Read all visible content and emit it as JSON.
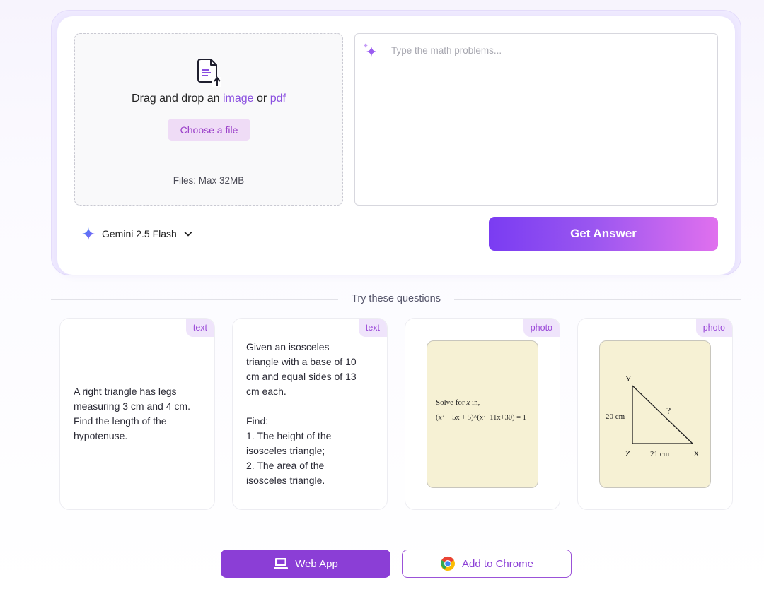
{
  "upload": {
    "drop_prefix": "Drag and drop an",
    "drop_image": "image",
    "drop_or": "or",
    "drop_pdf": "pdf",
    "choose_label": "Choose a file",
    "max_size": "Files: Max 32MB"
  },
  "input": {
    "placeholder": "Type the math problems..."
  },
  "model": {
    "name": "Gemini 2.5 Flash",
    "icon": "gemini-sparkle-icon"
  },
  "actions": {
    "get_answer": "Get Answer"
  },
  "examples": {
    "title": "Try these questions",
    "cards": [
      {
        "tag": "text",
        "lines": [
          "A right triangle has legs",
          "measuring 3 cm and 4 cm.",
          "Find the length of the",
          "hypotenuse."
        ]
      },
      {
        "tag": "text",
        "lines": [
          "Given an isosceles",
          "triangle with a base of 10",
          "cm and equal sides of 13",
          "cm each.",
          "",
          "Find:",
          "1. The height of the",
          "isosceles triangle;",
          "2. The area of the",
          "isosceles triangle."
        ]
      },
      {
        "tag": "photo",
        "photo_line1_prefix": "Solve for",
        "photo_var": "x",
        "photo_line1_suffix": "in,",
        "equation": "(x² − 5x + 5)^(x²−11x+30) = 1"
      },
      {
        "tag": "photo",
        "vertex_y": "Y",
        "vertex_z": "Z",
        "vertex_x": "X",
        "side_yz": "20 cm",
        "side_zx": "21 cm",
        "unknown": "?"
      }
    ]
  },
  "footer": {
    "web_app": "Web App",
    "add_chrome": "Add to Chrome"
  },
  "colors": {
    "accent": "#8a4fe0",
    "button_gradient_start": "#7a3cf2",
    "button_gradient_end": "#e070ee",
    "web_app_bg": "#8b3ed6"
  }
}
